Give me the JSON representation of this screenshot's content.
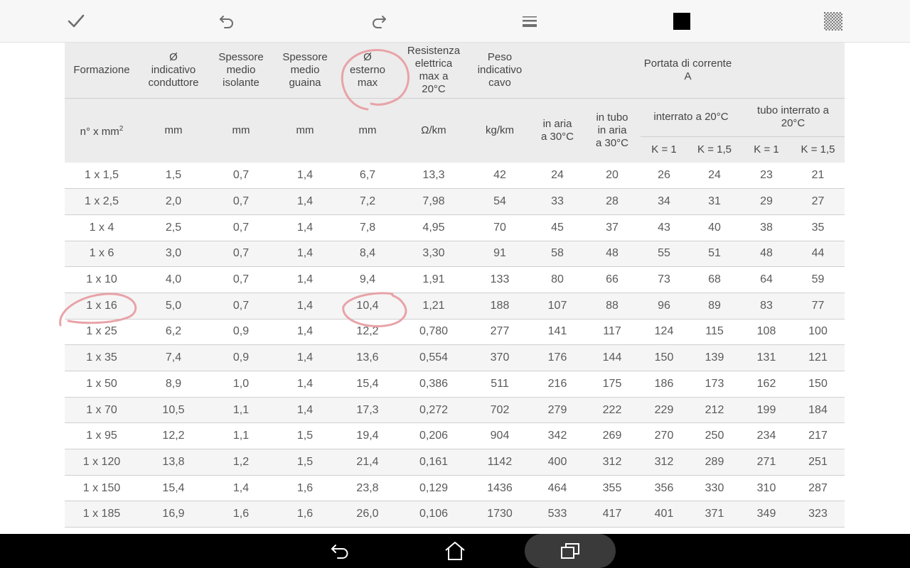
{
  "toolbar": {
    "icons": [
      "check-icon",
      "undo-icon",
      "redo-icon",
      "line-weight-icon",
      "color-swatch-icon",
      "transparency-icon"
    ],
    "colors": {
      "swatch": "#000000",
      "icon": "#6f6f6f"
    }
  },
  "table": {
    "headers": {
      "formazione": "Formazione",
      "diam_conduttore": [
        "Ø",
        "indicativo",
        "conduttore"
      ],
      "spessore_isolante": [
        "Spessore",
        "medio",
        "isolante"
      ],
      "spessore_guaina": [
        "Spessore",
        "medio",
        "guaina"
      ],
      "diam_esterno": [
        "Ø",
        "esterno",
        "max"
      ],
      "resistenza": [
        "Resistenza",
        "elettrica",
        "max a",
        "20°C"
      ],
      "peso": [
        "Peso",
        "indicativo",
        "cavo"
      ],
      "portata": [
        "Portata di corrente",
        "A"
      ],
      "in_aria": [
        "in aria",
        "a 30°C"
      ],
      "in_tubo": [
        "in tubo",
        "in aria",
        "a 30°C"
      ],
      "interrato": "interrato a 20°C",
      "tubo_interrato": [
        "tubo interrato a",
        "20°C"
      ],
      "k1": "K = 1",
      "k15": "K = 1,5"
    },
    "units": {
      "formazione": "n° x mm",
      "formazione_sup": "2",
      "diam_conduttore": "mm",
      "spessore_isolante": "mm",
      "spessore_guaina": "mm",
      "diam_esterno": "mm",
      "resistenza": "Ω/km",
      "peso": "kg/km"
    },
    "rows": [
      [
        "1 x 1,5",
        "1,5",
        "0,7",
        "1,4",
        "6,7",
        "13,3",
        "42",
        "24",
        "20",
        "26",
        "24",
        "23",
        "21"
      ],
      [
        "1 x 2,5",
        "2,0",
        "0,7",
        "1,4",
        "7,2",
        "7,98",
        "54",
        "33",
        "28",
        "34",
        "31",
        "29",
        "27"
      ],
      [
        "1 x 4",
        "2,5",
        "0,7",
        "1,4",
        "7,8",
        "4,95",
        "70",
        "45",
        "37",
        "43",
        "40",
        "38",
        "35"
      ],
      [
        "1 x 6",
        "3,0",
        "0,7",
        "1,4",
        "8,4",
        "3,30",
        "91",
        "58",
        "48",
        "55",
        "51",
        "48",
        "44"
      ],
      [
        "1 x 10",
        "4,0",
        "0,7",
        "1,4",
        "9,4",
        "1,91",
        "133",
        "80",
        "66",
        "73",
        "68",
        "64",
        "59"
      ],
      [
        "1 x 16",
        "5,0",
        "0,7",
        "1,4",
        "10,4",
        "1,21",
        "188",
        "107",
        "88",
        "96",
        "89",
        "83",
        "77"
      ],
      [
        "1 x 25",
        "6,2",
        "0,9",
        "1,4",
        "12,2",
        "0,780",
        "277",
        "141",
        "117",
        "124",
        "115",
        "108",
        "100"
      ],
      [
        "1 x 35",
        "7,4",
        "0,9",
        "1,4",
        "13,6",
        "0,554",
        "370",
        "176",
        "144",
        "150",
        "139",
        "131",
        "121"
      ],
      [
        "1 x 50",
        "8,9",
        "1,0",
        "1,4",
        "15,4",
        "0,386",
        "511",
        "216",
        "175",
        "186",
        "173",
        "162",
        "150"
      ],
      [
        "1 x 70",
        "10,5",
        "1,1",
        "1,4",
        "17,3",
        "0,272",
        "702",
        "279",
        "222",
        "229",
        "212",
        "199",
        "184"
      ],
      [
        "1 x 95",
        "12,2",
        "1,1",
        "1,5",
        "19,4",
        "0,206",
        "904",
        "342",
        "269",
        "270",
        "250",
        "234",
        "217"
      ],
      [
        "1 x 120",
        "13,8",
        "1,2",
        "1,5",
        "21,4",
        "0,161",
        "1142",
        "400",
        "312",
        "312",
        "289",
        "271",
        "251"
      ],
      [
        "1 x 150",
        "15,4",
        "1,4",
        "1,6",
        "23,8",
        "0,129",
        "1436",
        "464",
        "355",
        "356",
        "330",
        "310",
        "287"
      ],
      [
        "1 x 185",
        "16,9",
        "1,6",
        "1,6",
        "26,0",
        "0,106",
        "1730",
        "533",
        "417",
        "401",
        "371",
        "349",
        "323"
      ]
    ]
  },
  "annotations": {
    "color": "#e8a3a8",
    "circled": [
      "esterno max header",
      "1 x 16",
      "10,4"
    ]
  },
  "navbar": {
    "icons": [
      "back-icon",
      "home-icon",
      "recents-icon"
    ]
  }
}
